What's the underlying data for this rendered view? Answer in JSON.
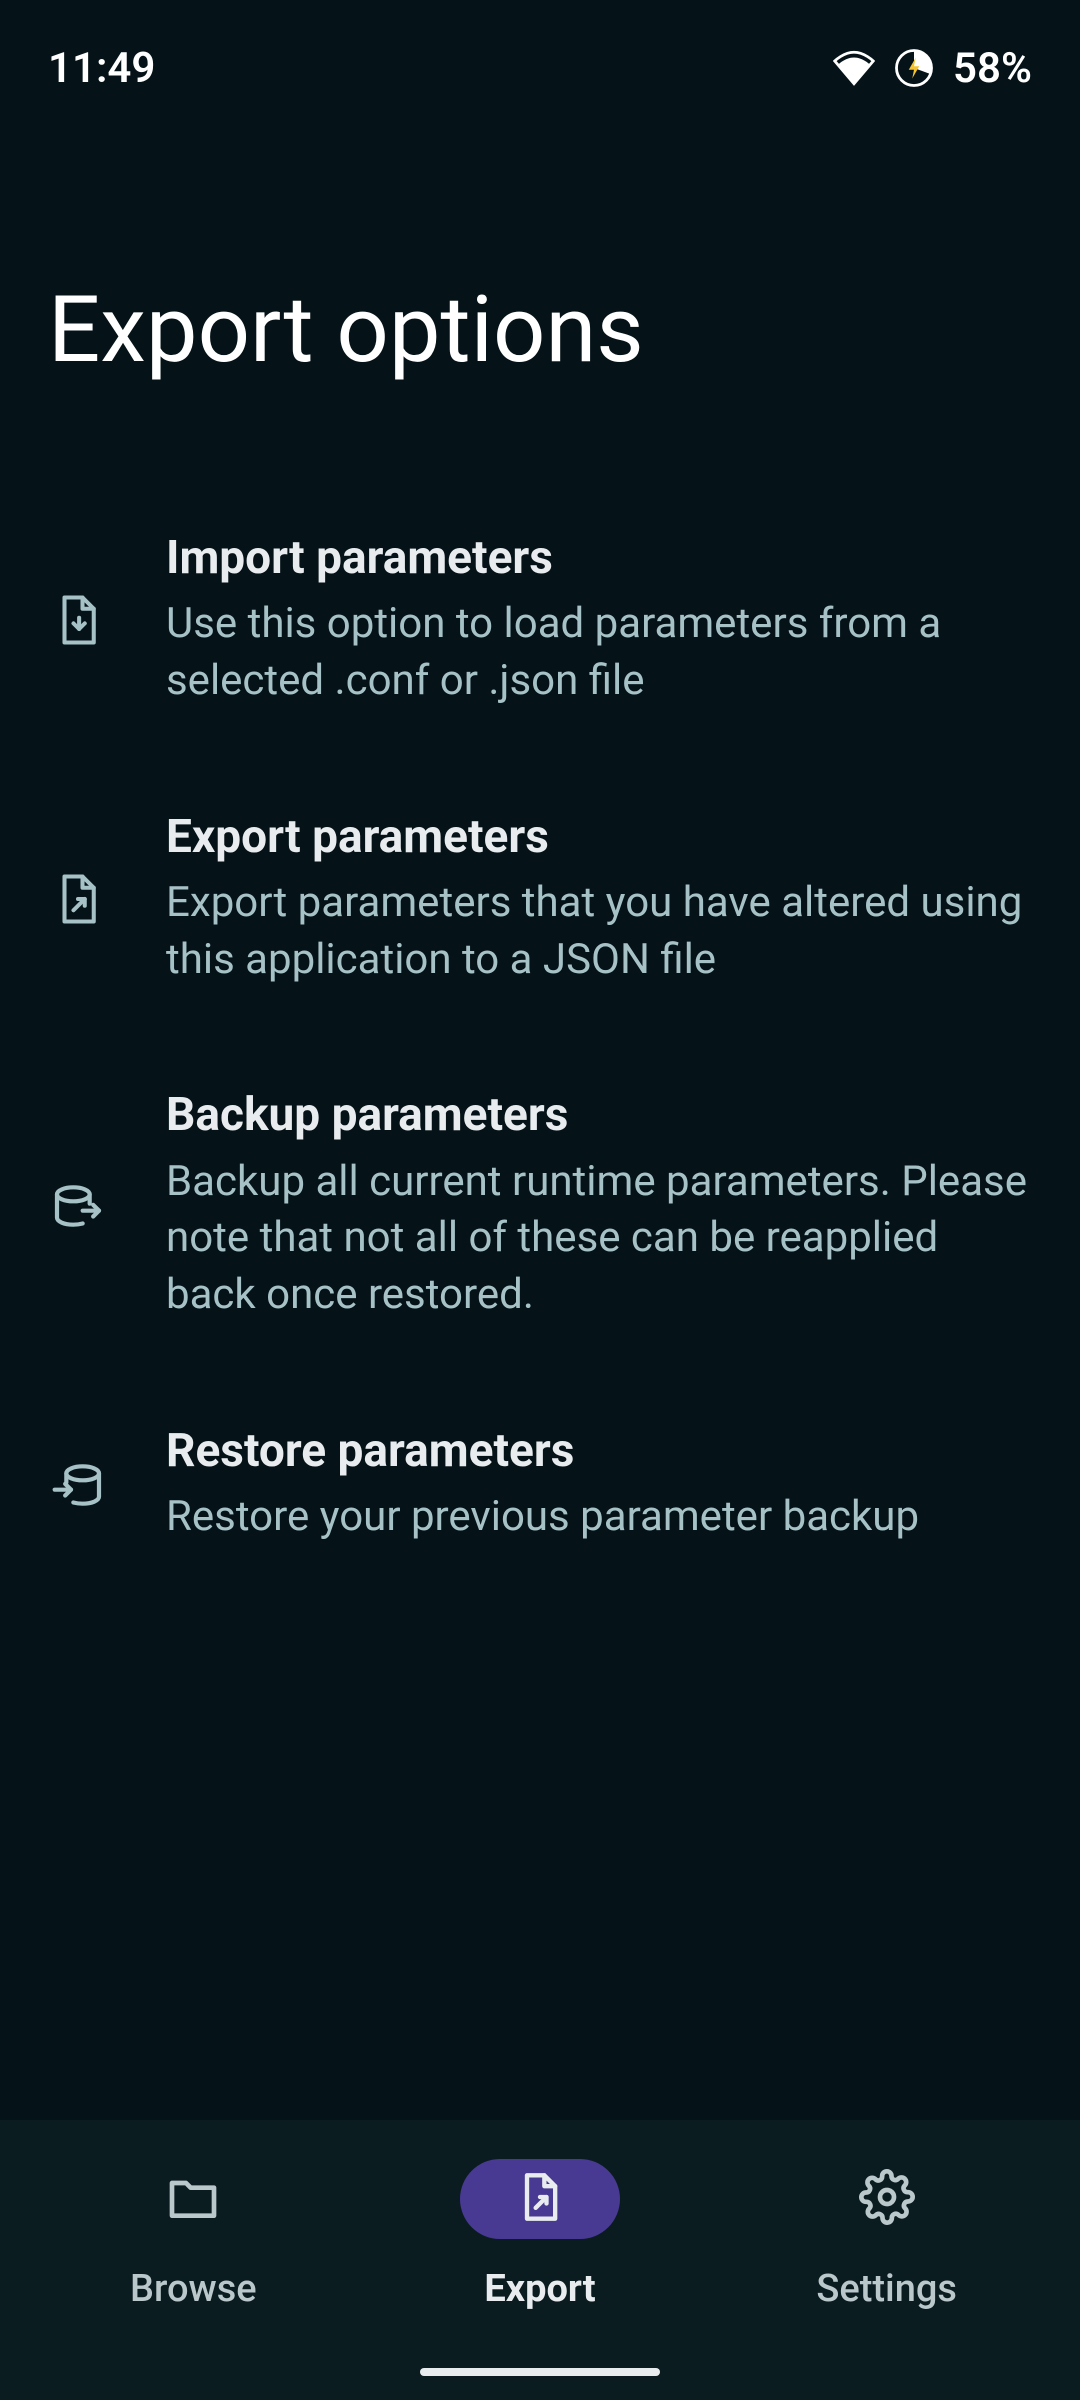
{
  "status_bar": {
    "time": "11:49",
    "battery_pct": "58%"
  },
  "page": {
    "title": "Export options"
  },
  "options": [
    {
      "title": "Import parameters",
      "desc": "Use this option to load parameters from a selected .conf or .json file"
    },
    {
      "title": "Export parameters",
      "desc": "Export parameters that you have altered using this application to a JSON file"
    },
    {
      "title": "Backup parameters",
      "desc": "Backup all current runtime parameters. Please note that not all of these can be reapplied back once restored."
    },
    {
      "title": "Restore parameters",
      "desc": "Restore your previous parameter backup"
    }
  ],
  "nav": [
    {
      "label": "Browse"
    },
    {
      "label": "Export"
    },
    {
      "label": "Settings"
    }
  ]
}
